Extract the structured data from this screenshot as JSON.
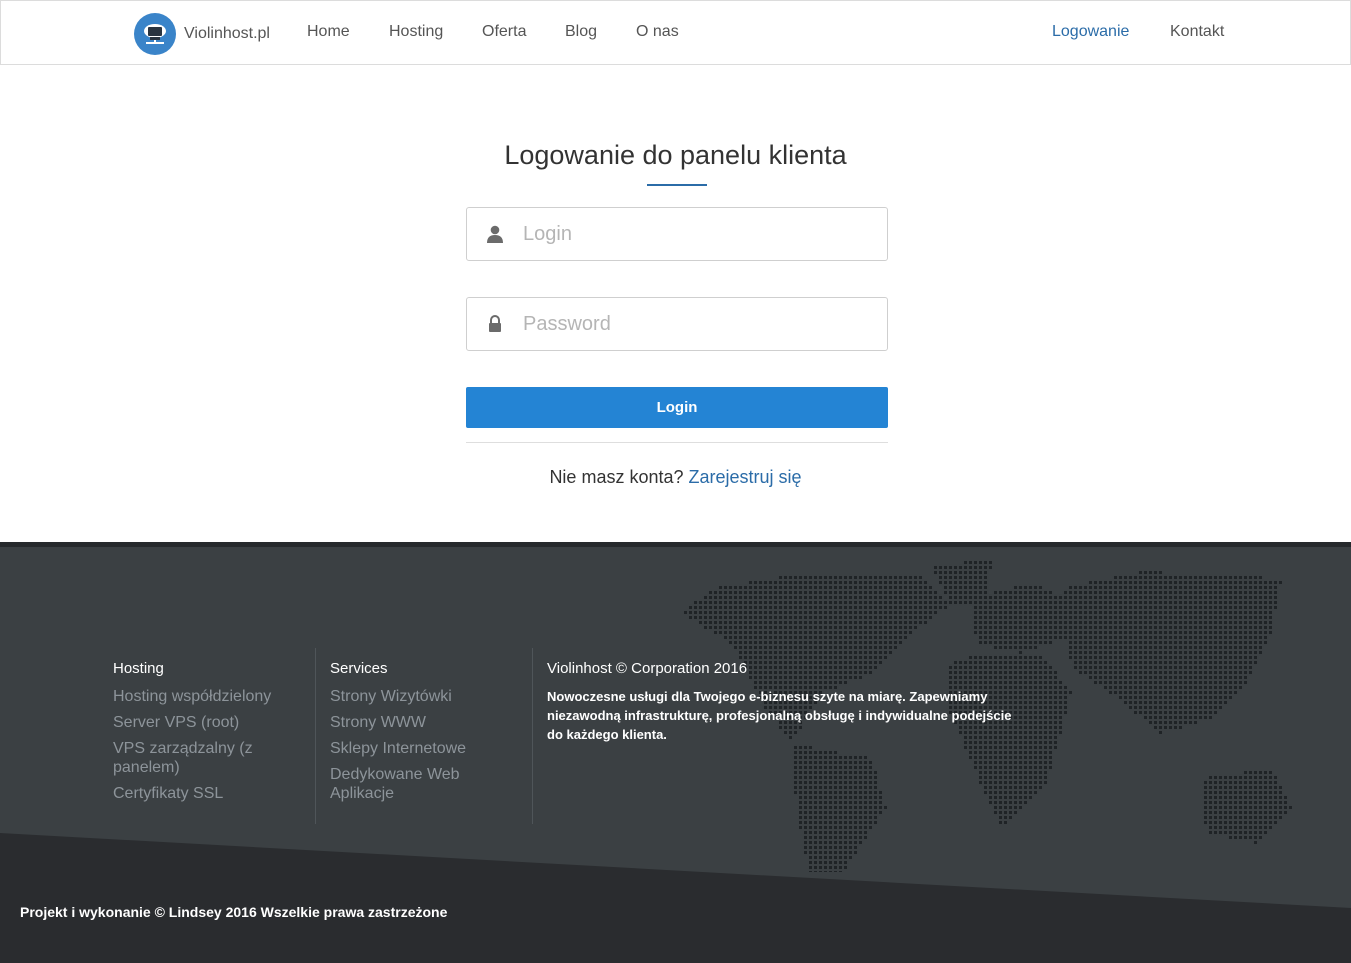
{
  "brand": {
    "name": "Violinhost.pl"
  },
  "nav": {
    "home": "Home",
    "hosting": "Hosting",
    "oferta": "Oferta",
    "blog": "Blog",
    "onas": "O nas",
    "logowanie": "Logowanie",
    "kontakt": "Kontakt"
  },
  "login": {
    "title": "Logowanie do panelu klienta",
    "login_placeholder": "Login",
    "password_placeholder": "Password",
    "button_label": "Login",
    "no_account_text": "Nie masz konta?",
    "register_link": "Zarejestruj się"
  },
  "footer": {
    "hosting": {
      "title": "Hosting",
      "links": [
        "Hosting współdzielony",
        "Server VPS (root)",
        "VPS zarządzalny (z panelem)",
        "Certyfikaty SSL"
      ]
    },
    "services": {
      "title": "Services",
      "links": [
        "Strony Wizytówki",
        "Strony WWW",
        "Sklepy Internetowe",
        "Dedykowane Web Aplikacje"
      ]
    },
    "about": {
      "title": "Violinhost © Corporation 2016",
      "text": "Nowoczesne usługi dla Twojego e-biznesu szyte na miarę. Zapewniamy niezawodną infrastrukturę, profesjonalną obsługę i indywidualne podejście do każdego klienta."
    },
    "copyright": "Projekt i wykonanie © Lindsey 2016 Wszelkie prawa zastrzeżone"
  },
  "icons": {
    "logo": "cloud-server-icon",
    "login_field": "user-icon",
    "password_field": "lock-icon",
    "footer_background": "world-map-dots"
  },
  "colors": {
    "accent": "#2484d4",
    "link": "#2b6ca8",
    "footer_bg": "#3b4043",
    "footer_dark": "#26292c"
  }
}
